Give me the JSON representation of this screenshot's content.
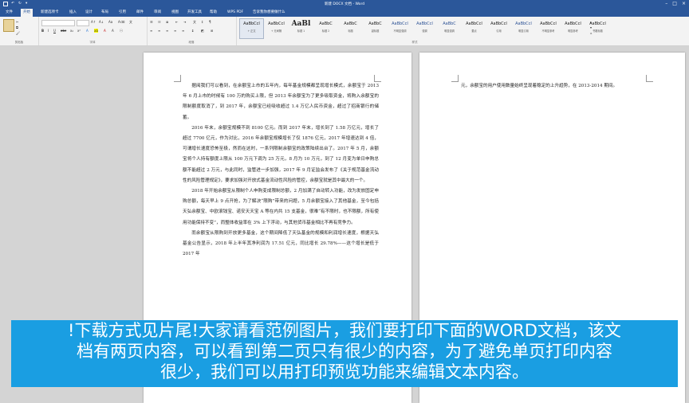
{
  "window": {
    "title": "新建 DOCX 文档 - Word"
  },
  "tabs": [
    "文件",
    "开始",
    "新建选项卡",
    "插入",
    "设计",
    "布局",
    "引用",
    "邮件",
    "审阅",
    "视图",
    "开发工具",
    "帮助",
    "WPS PDF",
    "告诉我你想要做什么"
  ],
  "active_tab": 1,
  "ribbon": {
    "groups": [
      "剪贴板",
      "字体",
      "段落",
      "样式"
    ],
    "styles": [
      {
        "preview": "AaBbCcI",
        "name": "+ 正文",
        "variant": "sel"
      },
      {
        "preview": "AaBbCcI",
        "name": "+ 无间隔",
        "variant": ""
      },
      {
        "preview": "AaBl",
        "name": "标题 1",
        "variant": "big"
      },
      {
        "preview": "AaBbC",
        "name": "标题 2",
        "variant": ""
      },
      {
        "preview": "AaBbC",
        "name": "标题",
        "variant": ""
      },
      {
        "preview": "AaBbC",
        "name": "副标题",
        "variant": ""
      },
      {
        "preview": "AaBbCcI",
        "name": "不明显强调",
        "variant": "blue"
      },
      {
        "preview": "AaBbCcI",
        "name": "强调",
        "variant": "blue"
      },
      {
        "preview": "AaBbC",
        "name": "明显强调",
        "variant": "blue"
      },
      {
        "preview": "AaBbCcI",
        "name": "要点",
        "variant": ""
      },
      {
        "preview": "AaBbCcI",
        "name": "引用",
        "variant": ""
      },
      {
        "preview": "AaBbCcI",
        "name": "明显引用",
        "variant": "blue"
      },
      {
        "preview": "AaBbCcI",
        "name": "不明显参考",
        "variant": ""
      },
      {
        "preview": "AaBbCcI",
        "name": "明显参考",
        "variant": ""
      },
      {
        "preview": "AaBbCcI",
        "name": "书籍标题",
        "variant": ""
      }
    ]
  },
  "page1": {
    "paragraphs": [
      "据阅我们可以看到，在余额宝上市的五年内，每年基金规模都呈现增长模式，余额宝于 2013 年 6 月上市的时候有 100 万的购买上限，但 2013 年余额宝为了更多吸取资金，将购入余额宝的限制额度取消了，到 2017 年，余额宝已经吸收超过 1.4 万亿人民币资金，超过了招商银行的储蓄。",
      "2016 年末，余额宝规模不到 8100 亿元。而到 2017 年末，增长到了 1.58 万亿元，增长了超过 7700 亿元，作为对比，2016 年余额宝规模增长了仅 1876 亿元，2017 年增速达到 4 倍，可谓增长速度恐怖至极，然而在这时，一系列限制余额宝的政策陆续出台了。2017 年 5 月，余额宝将个人持有额度上限从 100 万元下调为 25 万元，8 月为 10 万元，到了 12 月变为单日申购总额不能超过 2 万元，与此同时，监管进一步加强，2017 年 9 月证监会发布了《关于规范基金流动性的风险管理规定》，要求加强对开放式基金流动性风险的管控，余额宝就是其中最大的一个。",
      "2018 年开始余额宝从限制个人申购变成限制总额，2 月加满了自动转入功能，改为发放固定申购总额，每天早上 9 点开抢，为了解决“限购”带来的问题，5 月余额宝接入了其他基金，至今包括天弘余额宝、中欧滚钱宝、诺安天天宝 A 等在内共 15 支基金，很难“有不限时，也不限额，所有使用功能保持不变”，而整体收益率在 3% 上下浮动，与其他货币基金相比不再有竞争力。",
      "而余额宝从限购到开放更多基金，这个期间降低了天弘基金的规模和利润增长速度，根据天弘基金公告显示，2018 年上半年其净利润为 17.51 亿元，同比增长 29.78%——这个增长是低于 2017 年"
    ]
  },
  "page2": {
    "paragraphs": [
      "元，余额宝的用户使用数量始终呈现着稳定的上升趋势，在 2013-2014 期间。"
    ]
  },
  "caption": {
    "lines": [
      "!下载方式见片尾!大家请看范例图片，我们要打印下面的WORD文档，该文",
      "档有两页内容，可以看到第二页只有很少的内容，为了避免单页打印内容",
      "很少，我们可以用打印预览功能来编辑文本内容。"
    ]
  }
}
